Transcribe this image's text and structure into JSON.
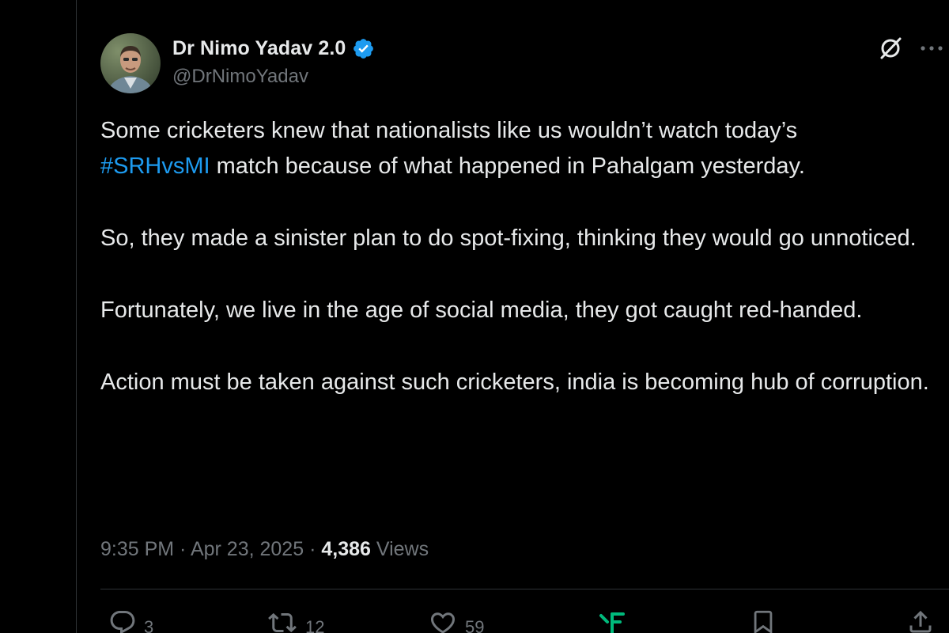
{
  "author": {
    "display_name": "Dr Nimo Yadav 2.0",
    "handle": "@DrNimoYadav",
    "verified_color": "#1d9bf0"
  },
  "tweet": {
    "paragraphs": [
      {
        "hashtag": "",
        "text": "Some cricketers knew that nationalists like us wouldn’t watch today’s",
        "hashtag2": "#SRHvsMI",
        "text2": " match because of what happened in Pahalgam yesterday."
      },
      {
        "text": "So, they made a sinister plan to do spot-fixing, thinking they would go unnoticed."
      },
      {
        "text": "Fortunately, we live in the age of social media, they got caught red-handed."
      },
      {
        "text": "Action must be taken against such cricketers, india is becoming hub of corruption."
      }
    ]
  },
  "meta": {
    "time": "9:35 PM",
    "separator": " · ",
    "date": "Apr 23, 2025",
    "separator2": " · ",
    "views_count": "4,386",
    "views_label": " Views"
  },
  "actions": {
    "reply_count": "3",
    "retweet_count": "12",
    "like_count": "59"
  },
  "icons": {
    "grok": "grok-icon",
    "more": "more-icon",
    "reply": "reply-icon",
    "retweet": "retweet-icon",
    "like": "heart-icon",
    "analytics": "analytics-icon",
    "bookmark": "bookmark-icon",
    "share": "share-icon"
  },
  "colors": {
    "background": "#000000",
    "text": "#e7e9ea",
    "secondary": "#71767b",
    "accent": "#1d9bf0",
    "analytics_accent": "#00ba7c"
  }
}
